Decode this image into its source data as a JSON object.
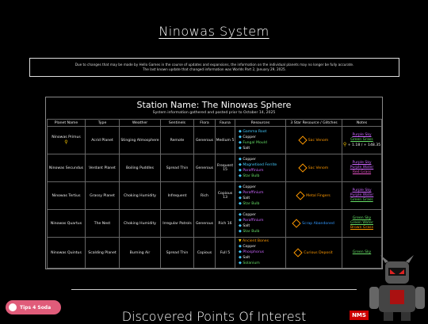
{
  "page": {
    "title": "Ninowas System",
    "notice_line1": "Due to changes that may be made by Hello Games in the course of updates and expansions, the information on the individual planets may no longer be fully accurate.",
    "notice_line2": "The last known update that changed information was Worlds Part 2, January 29, 2025."
  },
  "station": {
    "name": "Station Name: The Ninowas Sphere",
    "subtitle": "System information gathered and posted prior to October 14, 2025"
  },
  "table": {
    "headers": [
      "Planet Name",
      "Type",
      "Weather",
      "Sentinels",
      "Flora",
      "Fauna",
      "Resources",
      "3 Star Resource / Glitches",
      "Notes"
    ],
    "rows": [
      {
        "planet": "Ninowas Primus",
        "type": "Acrid Planet",
        "weather": "Stinging Atmosphere",
        "sentinels": "Remote",
        "flora": "Generous",
        "fauna": "Medium 5",
        "resources": [
          "Gamma Root",
          "Copper",
          "Fungal Mould",
          "Salt"
        ],
        "glitch": "Sac Venom",
        "notes": [
          "Purple Sky",
          "Green Grass"
        ],
        "coords": "+ 1.18 / + 148.35"
      },
      {
        "planet": "Ninowas Secundus",
        "type": "Verdant Planet",
        "weather": "Boiling Puddles",
        "sentinels": "Spread Thin",
        "flora": "Generous",
        "fauna": "Frequent 15",
        "resources": [
          "Copper",
          "Magnetised Ferrite",
          "Paraffinium",
          "Star Bulb"
        ],
        "glitch": "Sac Venom",
        "notes": [
          "Purple Sky",
          "Purple Water",
          "Red Grass"
        ],
        "coords": ""
      },
      {
        "planet": "Ninowas Tertius",
        "type": "Grassy Planet",
        "weather": "Choking Humidity",
        "sentinels": "Infrequent",
        "flora": "Rich",
        "fauna": "Copious 13",
        "resources": [
          "Copper",
          "Paraffinium",
          "Salt",
          "Star Bulb"
        ],
        "glitch": "Metal Fingers",
        "notes": [
          "Purple Sky",
          "Purple Water",
          "Green Grass"
        ],
        "coords": ""
      },
      {
        "planet": "Ninowas Quartus",
        "type": "The Nest",
        "weather": "Choking Humidity",
        "sentinels": "Irregular Patrols",
        "flora": "Generous",
        "fauna": "Rich 16",
        "resources": [
          "Copper",
          "Paraffinium",
          "Salt",
          "Star Bulb"
        ],
        "glitch": "Scrap Abandoned",
        "notes": [
          "Green Sky",
          "Green Water",
          "Brown Grass"
        ],
        "coords": ""
      },
      {
        "planet": "Ninowas Quintus",
        "type": "Scalding Planet",
        "weather": "Burning Air",
        "sentinels": "Spread Thin",
        "flora": "Copious",
        "fauna": "Full 5",
        "resources": [
          "Ancient Bones",
          "Copper",
          "Phosphorus",
          "Salt",
          "Solanium"
        ],
        "glitch": "Curious Deposit",
        "notes": [
          "Green Sky"
        ],
        "coords": ""
      }
    ]
  },
  "sections": {
    "discovered": "Discovered Points Of Interest"
  },
  "widgets": {
    "tips_label": "Tips 4 Soda",
    "logo_text": "NMS"
  },
  "colors": {
    "background": "#000000",
    "accent_green": "#66dd66",
    "accent_purple": "#cc66ff"
  }
}
